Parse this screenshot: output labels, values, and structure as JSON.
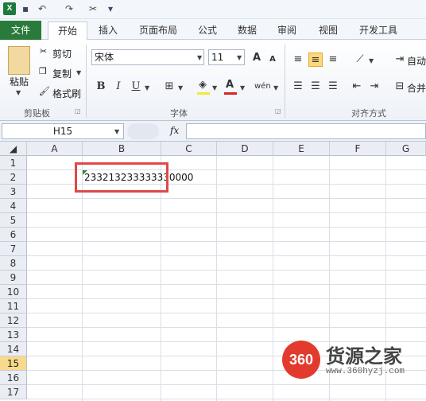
{
  "qat": {
    "logo": "X",
    "save_glyph": "💾",
    "undo_glyph": "↶",
    "redo_glyph": "↷",
    "customize_glyph": "▾"
  },
  "tabs": [
    {
      "label": "文件"
    },
    {
      "label": "开始"
    },
    {
      "label": "插入"
    },
    {
      "label": "页面布局"
    },
    {
      "label": "公式"
    },
    {
      "label": "数据"
    },
    {
      "label": "审阅"
    },
    {
      "label": "视图"
    },
    {
      "label": "开发工具"
    }
  ],
  "clipboard": {
    "paste_label": "粘贴",
    "cut_label": "剪切",
    "copy_label": "复制",
    "format_painter_label": "格式刷",
    "group_label": "剪贴板"
  },
  "font": {
    "name": "宋体",
    "size": "11",
    "bold": "B",
    "italic": "I",
    "underline": "U",
    "grow": "A",
    "shrink": "A",
    "color_glyph": "A",
    "phonetic": "wén",
    "group_label": "字体"
  },
  "alignment": {
    "wrap_label": "自动",
    "merge_label": "合并",
    "group_label": "对齐方式"
  },
  "formula_bar": {
    "name_box": "H15",
    "fx": "fx",
    "formula": ""
  },
  "columns": [
    "A",
    "B",
    "C",
    "D",
    "E",
    "F",
    "G"
  ],
  "rows": [
    "1",
    "2",
    "3",
    "4",
    "5",
    "6",
    "7",
    "8",
    "9",
    "10",
    "11",
    "12",
    "13",
    "14",
    "15",
    "16",
    "17"
  ],
  "active_row": "15",
  "cell_b2": "233213233333330000",
  "watermark": {
    "logo": "360",
    "title": "货源之家",
    "url": "www.360hyzj.com"
  },
  "colors": {
    "file_tab": "#2a7a3c",
    "highlight": "#e04848",
    "active_row_header": "#f9d98c"
  }
}
